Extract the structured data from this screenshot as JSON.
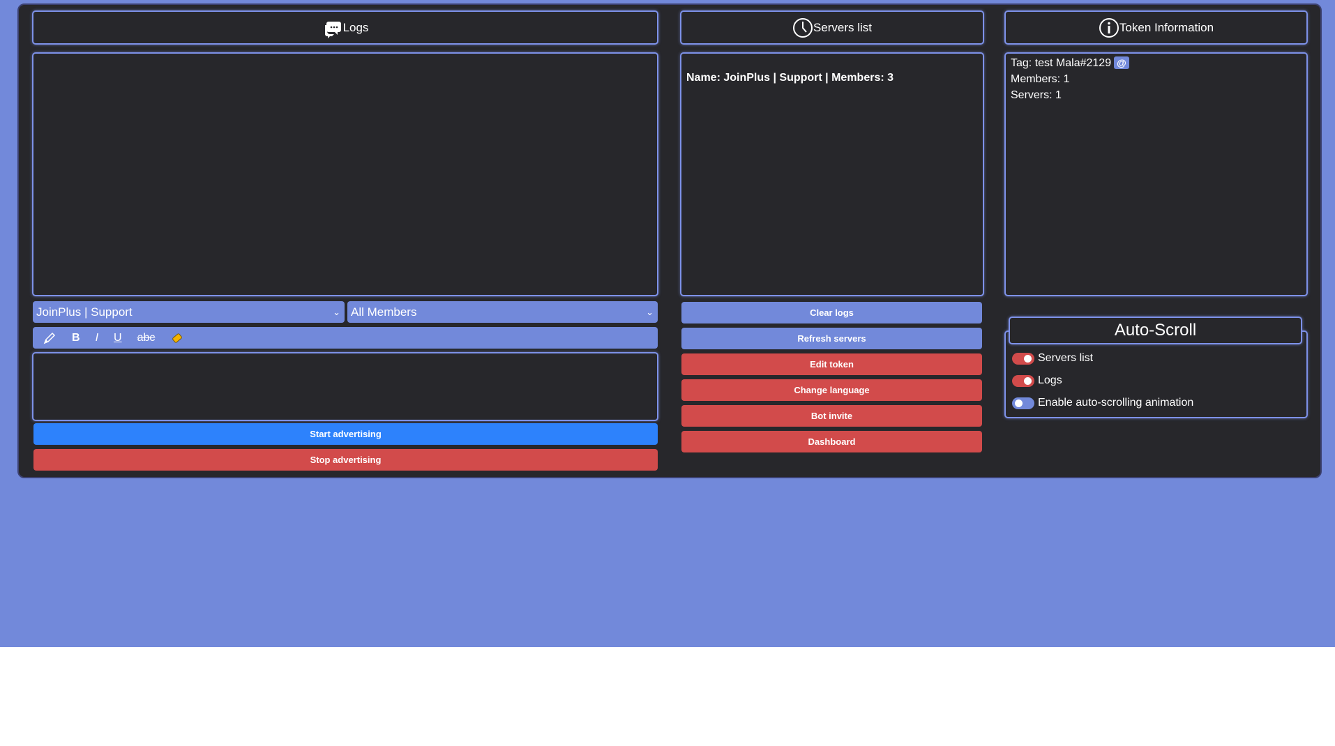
{
  "panels": {
    "logs": {
      "title": "Logs"
    },
    "servers": {
      "title": "Servers list",
      "entry": "Name: JoinPlus | Support | Members: 3"
    },
    "token": {
      "title": "Token Information",
      "tag": "Tag: test Mala#2129",
      "mention": "@",
      "members": "Members: 1",
      "servers": "Servers: 1"
    }
  },
  "selects": {
    "server": "JoinPlus | Support",
    "target": "All Members"
  },
  "toolbar": {
    "bold": "B",
    "italic": "I",
    "underline": "U",
    "strike": "abc"
  },
  "buttons": {
    "start": "Start advertising",
    "stop": "Stop advertising",
    "clear_logs": "Clear logs",
    "refresh_servers": "Refresh servers",
    "edit_token": "Edit token",
    "change_language": "Change language",
    "bot_invite": "Bot invite",
    "dashboard": "Dashboard"
  },
  "autoscroll": {
    "title": "Auto-Scroll",
    "items": [
      {
        "label": "Servers list",
        "on": true
      },
      {
        "label": "Logs",
        "on": true
      },
      {
        "label": "Enable auto-scrolling animation",
        "on": false
      }
    ]
  },
  "colors": {
    "background": "#7289da",
    "panel": "#27272b",
    "accent": "#7289da",
    "danger": "#d24b4b",
    "primary": "#2d82fc"
  }
}
